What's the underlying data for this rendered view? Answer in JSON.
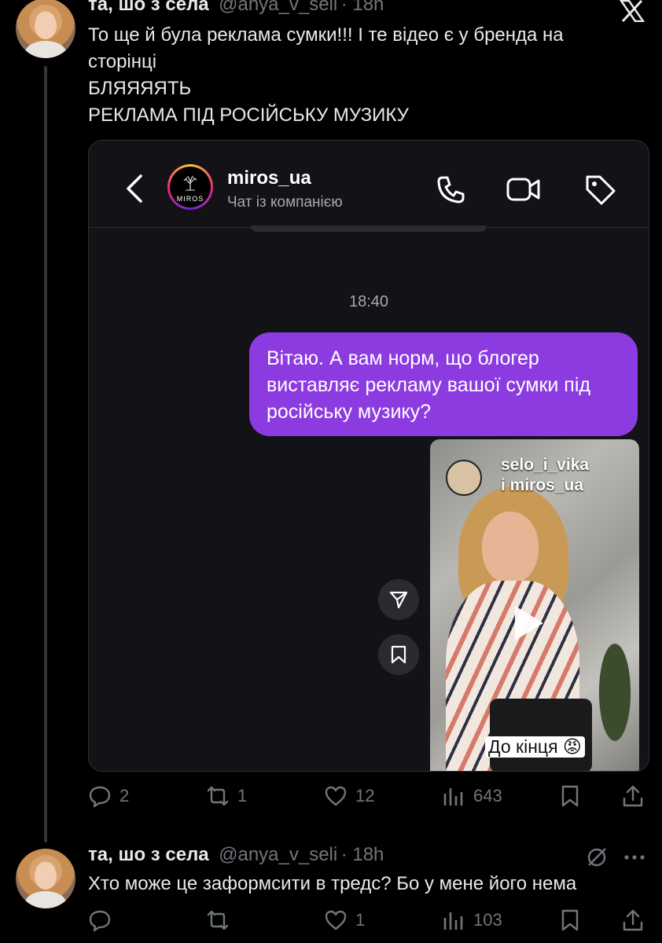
{
  "tweet1": {
    "name": "та, шо з села",
    "handle": "@anya_v_seli",
    "time": "· 18h",
    "text": "То ще й була реклама сумки!!! І те відео є у бренда на\nсторінці\nБЛЯЯЯЯТЬ\nРЕКЛАМА ПІД РОСІЙСЬКУ МУЗИКУ",
    "actions": {
      "replies": "2",
      "reposts": "1",
      "likes": "12",
      "views": "643"
    }
  },
  "embed": {
    "account": "miros_ua",
    "subtitle": "Чат із компанією",
    "logo_text": "MIROS",
    "time": "18:40",
    "message": "Вітаю. А вам норм, що блогер виставляє рекламу вашої сумки під російську музику?",
    "reel": {
      "author": "selo_i_vika",
      "collab": "і miros_ua",
      "caption": "До кінця 😡"
    }
  },
  "tweet2": {
    "name": "та, шо з села",
    "handle": "@anya_v_seli",
    "time": "· 18h",
    "text": "Хто може це заформсити в тредс? Бо у мене його нема",
    "actions": {
      "replies": "",
      "reposts": "",
      "likes": "1",
      "views": "103"
    }
  },
  "colors": {
    "bubble": "#8c3be0",
    "background": "#000000",
    "muted": "#71767b"
  }
}
